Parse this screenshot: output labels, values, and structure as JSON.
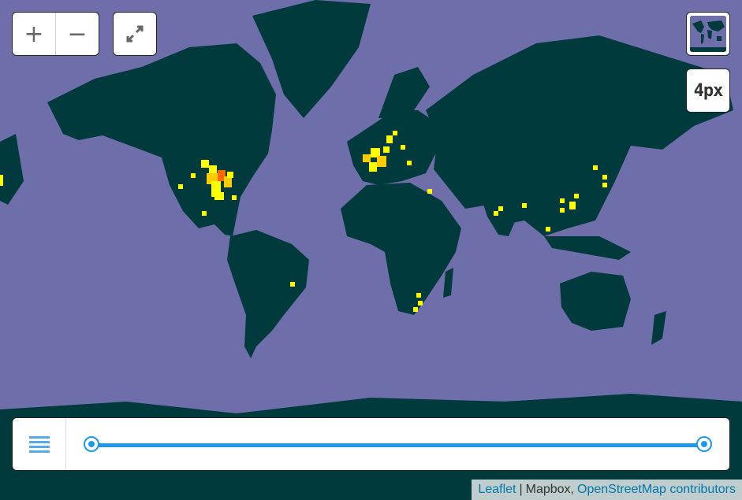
{
  "colors": {
    "water": "#6e6eaa",
    "land": "#003a3d",
    "heat_low": "#ffff00",
    "heat_mid": "#ffcc00",
    "heat_high": "#ff6a00",
    "accent": "#1e98e8"
  },
  "controls": {
    "zoom_in_label": "+",
    "zoom_out_label": "−",
    "fullscreen_icon": "fullscreen-icon",
    "minimap_icon": "world-map-icon",
    "pixel_size_label": "4px",
    "timeline_menu_icon": "hamburger-menu-icon"
  },
  "timeline": {
    "range_start": 0,
    "range_end": 1
  },
  "attribution": {
    "leaflet": "Leaflet",
    "separator": "|",
    "mapbox": "Mapbox,",
    "osm": "OpenStreetMap contributors"
  }
}
